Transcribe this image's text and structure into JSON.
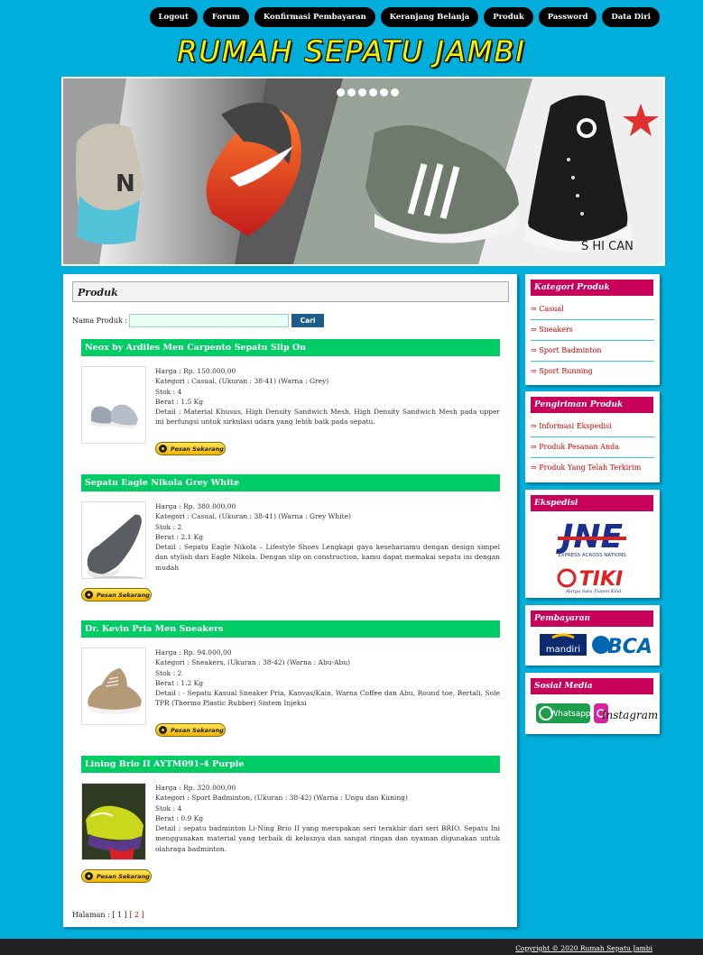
{
  "nav": [
    "Logout",
    "Forum",
    "Konfirmasi Pembayaran",
    "Keranjang Belanja",
    "Produk",
    "Password",
    "Data Diri"
  ],
  "site_title": "RUMAH SEPATU JAMBI",
  "banner_caption": "S HI CAN",
  "main": {
    "title": "Produk",
    "search_label": "Nama Produk :",
    "search_value": "",
    "search_button": "Cari",
    "order_label": "Pesan Sekarang",
    "products": [
      {
        "name": "Neox by Ardiles Men Carpento Sepatu Slip On",
        "price": "Harga : Rp. 150.000,00",
        "category": "Kategori : Casual, (Ukuran : 38-41) (Warna : Grey)",
        "stock": "Stok : 4",
        "weight": "Berat : 1.5 Kg",
        "detail": "Detail : Material Khusus, High Density Sandwich Mesh, High Density Sandwich Mesh pada upper ini berfungsi untuk sirkulasi udara yang lebih baik pada sepatu."
      },
      {
        "name": "Sepatu Eagle Nikola Grey White",
        "price": "Harga : Rp. 380.000,00",
        "category": "Kategori : Casual, (Ukuran : 38-41) (Warna : Grey White)",
        "stock": "Stok : 2",
        "weight": "Berat : 2.1 Kg",
        "detail": "Detail : Sepatu Eagle Nikola – Lifestyle Shoes Lengkapi gaya kesehariamu dengan design simpel dan stylish dari Eagle Nikola. Dengan slip on construction, kamu dapat memakai sepatu ini dengan mudah"
      },
      {
        "name": "Dr. Kevin Pria Men Sneakers",
        "price": "Harga : Rp. 94.000,00",
        "category": "Kategori : Sneakers, (Ukuran : 38-42) (Warna : Abu-Abu)",
        "stock": "Stok : 2",
        "weight": "Berat : 1.2 Kg",
        "detail": "Detail : - Sepatu Kasual Sneaker Pria, Kanvas/Kain, Warna Coffee dan Abu, Round toe, Bertali, Sole TPR (Thermo Plastic Rubber) Sistem Injeksi"
      },
      {
        "name": "Lining Brio II AYTM091-4 Purple",
        "price": "Harga : Rp. 320.000,00",
        "category": "Kategori : Sport Badminton, (Ukuran : 38-42) (Warna : Ungu dan Kuning)",
        "stock": "Stok : 4",
        "weight": "Berat : 0.9 Kg",
        "detail": "Detail : sepatu badminton Li-Ning Brio II yang merupakan seri terakhir dari seri BRIO. Sepatu Ini menggunakan material yang terbaik di kelasnya dan sangat ringan dan nyaman digunakan untuk olahraga badminton."
      }
    ],
    "pagination": {
      "label": "Halaman :",
      "current": "[ 1 ]",
      "other": "[ 2 ]"
    }
  },
  "sidebar": {
    "kategori": {
      "title": "Kategori Produk",
      "items": [
        "⇒ Casual",
        "⇒ Sneakers",
        "⇒ Sport Badminton",
        "⇒ Sport Running"
      ]
    },
    "pengiriman": {
      "title": "Pengiriman Produk",
      "items": [
        "⇒ Informasi Ekspedisi",
        "⇒ Produk Pesanan Anda",
        "⇒ Produk Yang Telah Terkirim"
      ]
    },
    "ekspedisi": {
      "title": "Ekspedisi",
      "jne": "JNE",
      "jne_tag": "EXPRESS ACROSS NATIONS",
      "tiki": "TIKI",
      "tiki_tag": "Harga Satu Tiapon Kilat"
    },
    "pembayaran": {
      "title": "Pembayaran",
      "bank1": "mandiri",
      "bank2": "BCA"
    },
    "sosial": {
      "title": "Sosial Media",
      "wa": "Whatsapp",
      "ig": "Instagram"
    }
  },
  "footer": "Copyright © 2020 Rumah Sepatu Jambi"
}
